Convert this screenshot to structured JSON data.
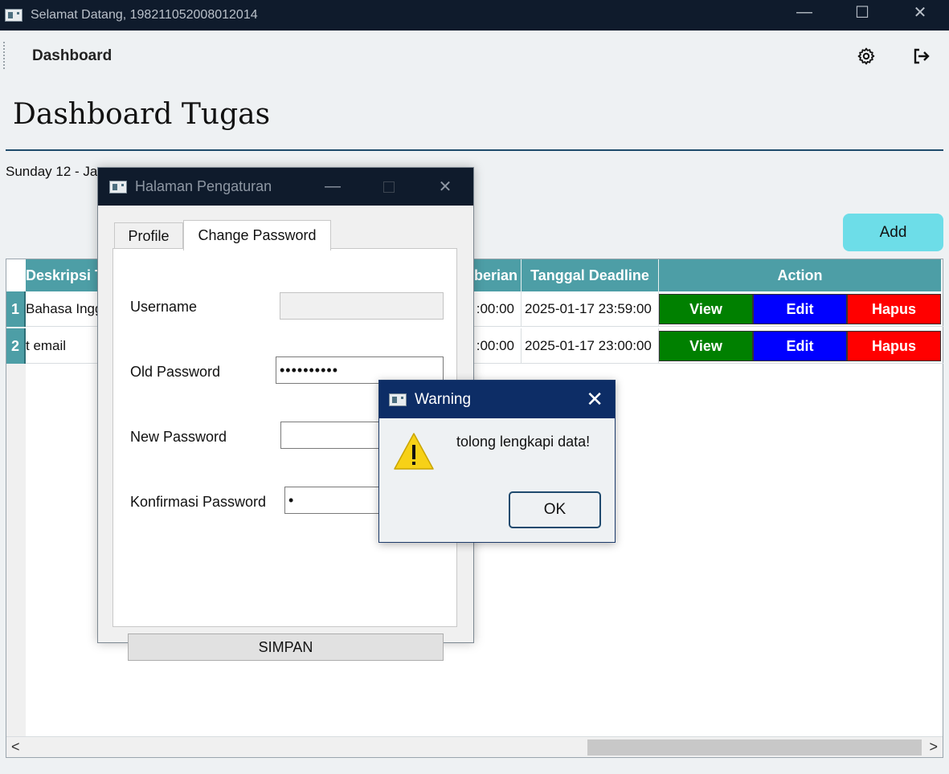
{
  "window": {
    "title": "Selamat Datang, 198211052008012014",
    "min": "—",
    "max": "☐",
    "close": "✕"
  },
  "toolbar": {
    "dashboard_label": "Dashboard",
    "settings_icon": "gear-icon",
    "logout_icon": "logout-icon"
  },
  "page": {
    "title": "Dashboard Tugas",
    "date": "Sunday 12 - Ja",
    "add_label": "Add"
  },
  "table": {
    "headers": [
      "Deskripsi T",
      "berian",
      "Tanggal Deadline",
      "Action"
    ],
    "rows": [
      {
        "num": "1",
        "deskripsi": "Bahasa Ingg",
        "pemberian": ":00:00",
        "deadline": "2025-01-17 23:59:00",
        "view": "View",
        "edit": "Edit",
        "hapus": "Hapus"
      },
      {
        "num": "2",
        "deskripsi": "t email",
        "pemberian": ":00:00",
        "deadline": "2025-01-17 23:00:00",
        "view": "View",
        "edit": "Edit",
        "hapus": "Hapus"
      }
    ],
    "scroll_left": "<",
    "scroll_right": ">"
  },
  "settings_dialog": {
    "title": "Halaman Pengaturan",
    "tabs": [
      "Profile",
      "Change Password"
    ],
    "labels": {
      "username": "Username",
      "old_password": "Old Password",
      "new_password": "New Password",
      "confirm_password": "Konfirmasi Password"
    },
    "values": {
      "username": "",
      "old_password": "••••••••••",
      "new_password": "",
      "confirm_password": "•"
    },
    "save_label": "SIMPAN",
    "min": "—",
    "close": "✕"
  },
  "warning_dialog": {
    "title": "Warning",
    "message": "tolong lengkapi data!",
    "ok_label": "OK",
    "close": "✕"
  },
  "colors": {
    "header_teal": "#4d9ea6",
    "view_green": "#008000",
    "edit_blue": "#0000ff",
    "hapus_red": "#ff0000",
    "add_cyan": "#6ddde8",
    "title_navy": "#0f1b2c"
  }
}
